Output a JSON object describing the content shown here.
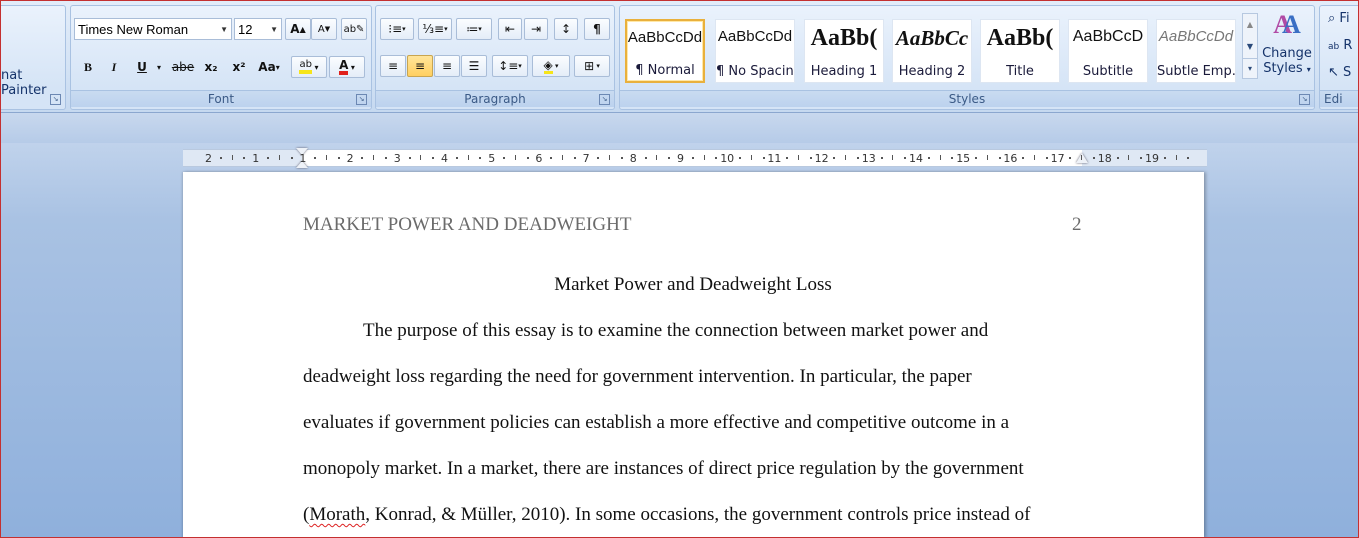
{
  "clipboard": {
    "format_painter_label": "nat Painter"
  },
  "font": {
    "name": "Times New Roman",
    "size": "12",
    "group_label": "Font",
    "bold": "B",
    "italic": "I",
    "underline": "U",
    "strike": "abe",
    "subscript": "x₂",
    "superscript": "x²",
    "change_case": "Aa",
    "grow": "A",
    "shrink": "A"
  },
  "paragraph": {
    "group_label": "Paragraph",
    "pilcrow": "¶"
  },
  "styles": {
    "group_label": "Styles",
    "tiles": [
      {
        "sample": "AaBbCcDd",
        "name": "¶ Normal"
      },
      {
        "sample": "AaBbCcDd",
        "name": "¶ No Spacing"
      },
      {
        "sample": "AaBb(",
        "name": "Heading 1"
      },
      {
        "sample": "AaBbCc",
        "name": "Heading 2"
      },
      {
        "sample": "AaBb(",
        "name": "Title"
      },
      {
        "sample": "AaBbCcD",
        "name": "Subtitle"
      },
      {
        "sample": "AaBbCcDd",
        "name": "Subtle Emp..."
      }
    ],
    "change_styles_line1": "Change",
    "change_styles_line2": "Styles"
  },
  "editing": {
    "group_label": "Edi",
    "find": "Fi",
    "replace": "R",
    "select": "S"
  },
  "ruler": {
    "labels": [
      "2",
      "1",
      "1",
      "2",
      "3",
      "4",
      "5",
      "6",
      "7",
      "8",
      "9",
      "10",
      "11",
      "12",
      "13",
      "14",
      "15",
      "16",
      "17",
      "18",
      "19"
    ]
  },
  "document": {
    "header": "MARKET POWER AND DEADWEIGHT",
    "page_number": "2",
    "title": "Market Power and Deadweight Loss",
    "lines": [
      "The purpose of this essay is to examine the connection between market power and",
      "deadweight loss regarding the need for government intervention. In particular, the paper",
      "evaluates if government policies can establish a more effective and competitive outcome in a",
      "monopoly market.  In a market, there are instances of direct price regulation by the government"
    ],
    "last_line_cite": "Morath",
    "last_line_open": "(",
    "last_line_rest": ", Konrad, & Müller, 2010).  In some occasions, the government controls price instead of"
  },
  "colors": {
    "highlight": "#f6e51a",
    "font_color": "#e0201b",
    "selected_style_border": "#e9b03c"
  }
}
